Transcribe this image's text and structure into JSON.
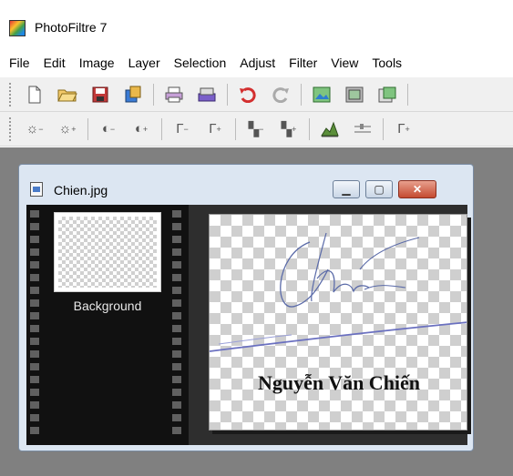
{
  "app": {
    "title": "PhotoFiltre 7"
  },
  "menu": [
    "File",
    "Edit",
    "Image",
    "Layer",
    "Selection",
    "Adjust",
    "Filter",
    "View",
    "Tools"
  ],
  "document": {
    "title": "Chien.jpg",
    "layer_name": "Background",
    "signature_text": "Nguyễn Văn Chiến",
    "signature_scrawl": "Chien"
  }
}
